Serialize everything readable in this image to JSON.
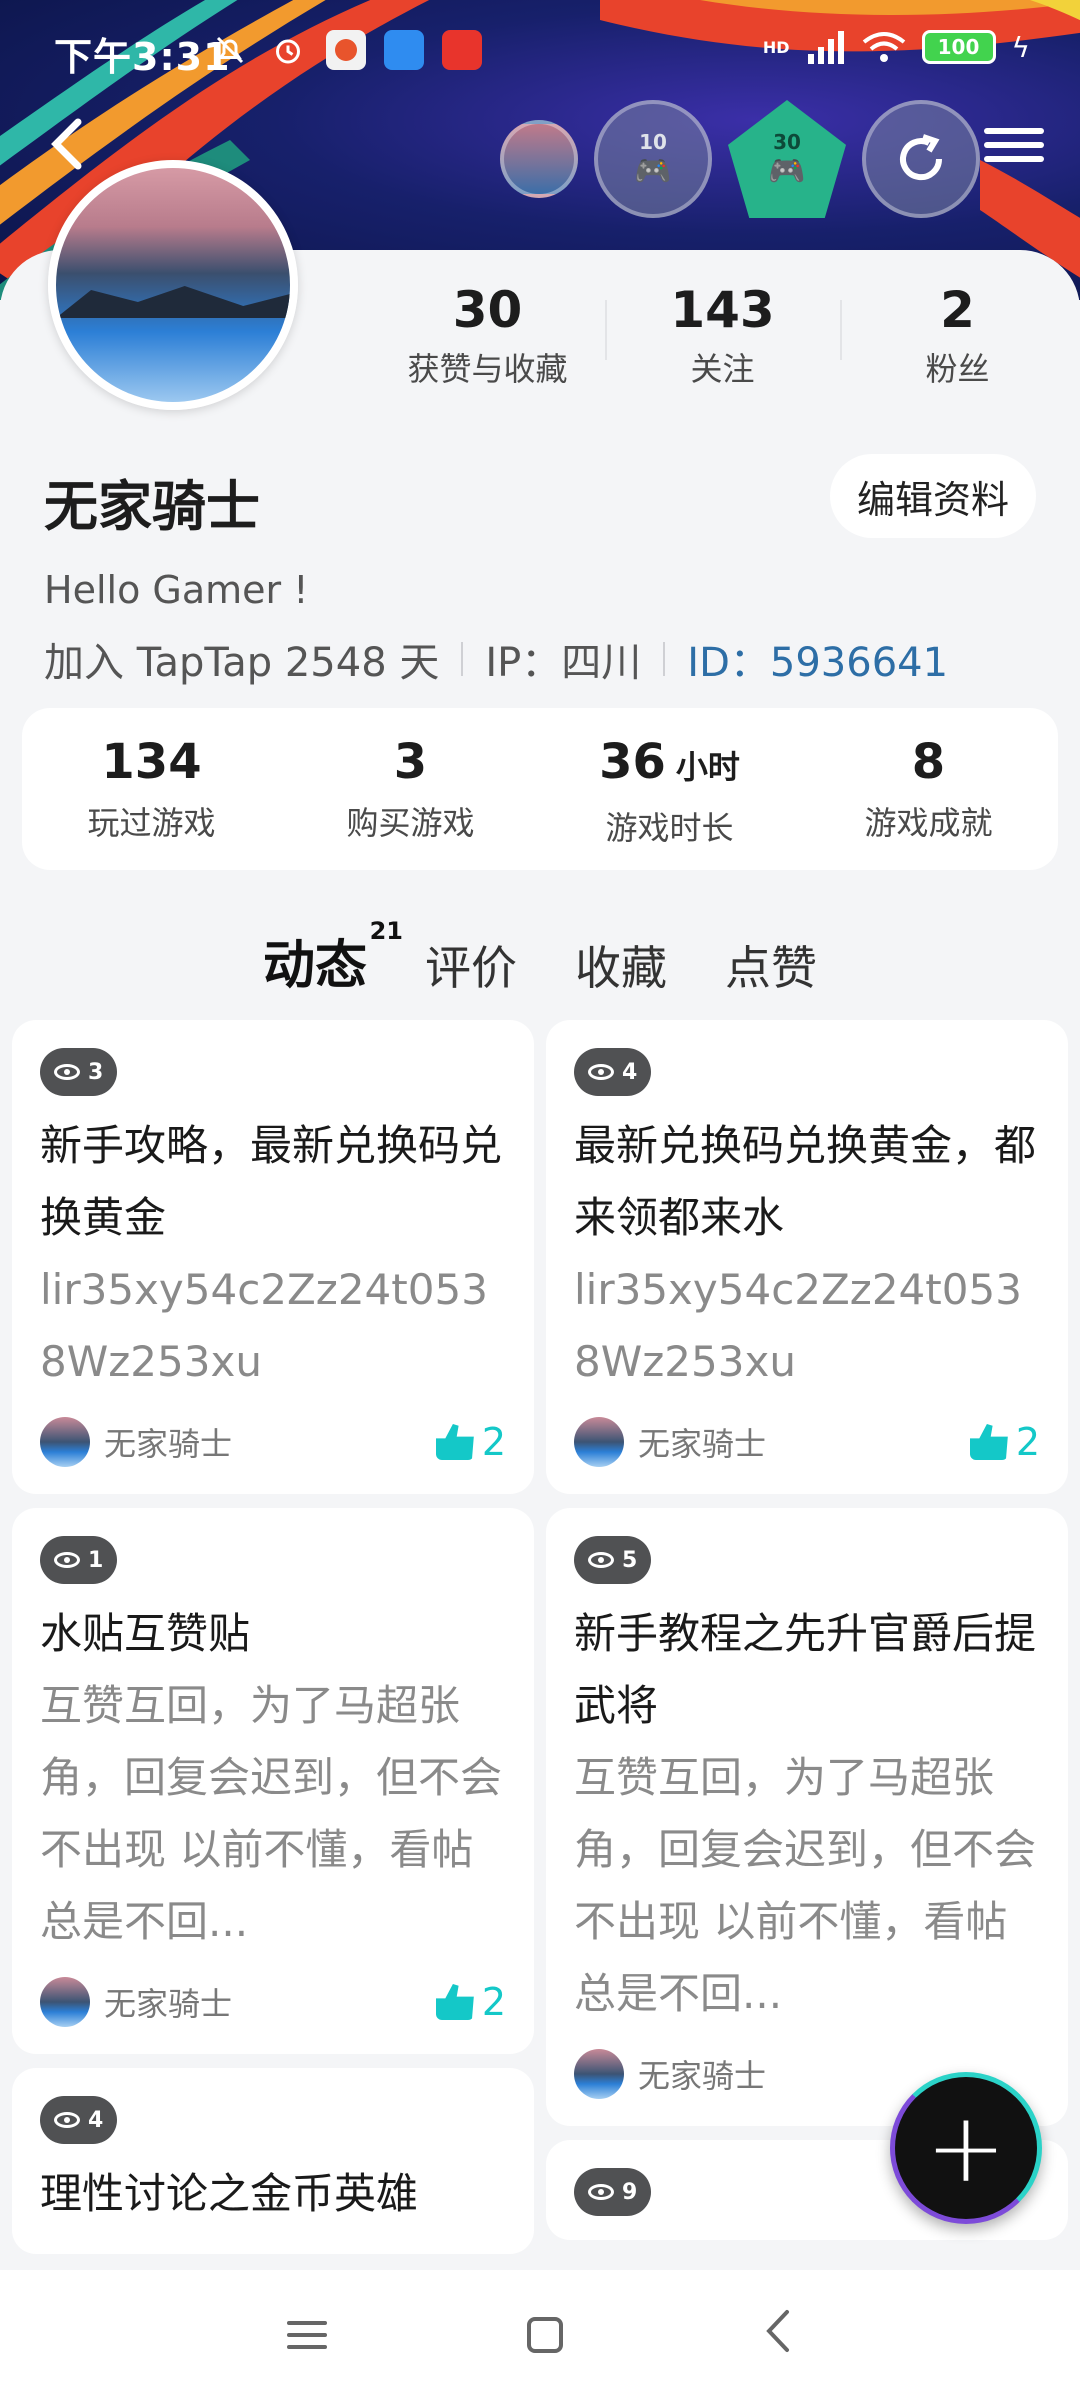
{
  "status_bar": {
    "time": "下午3:31",
    "network": "HD",
    "battery": "100",
    "app_icons": [
      "notification-off-icon",
      "alarm-icon",
      "app-icon-1",
      "app-icon-2",
      "app-icon-3"
    ]
  },
  "header": {
    "badges": [
      {
        "type": "small-avatar"
      },
      {
        "type": "circle",
        "number": "10"
      },
      {
        "type": "pentagon",
        "number": "30"
      },
      {
        "type": "circle-refresh"
      }
    ]
  },
  "profile": {
    "followers_stats": [
      {
        "num": "30",
        "label": "获赞与收藏"
      },
      {
        "num": "143",
        "label": "关注"
      },
      {
        "num": "2",
        "label": "粉丝"
      }
    ],
    "username": "无家骑士",
    "edit_label": "编辑资料",
    "bio": "Hello Gamer !",
    "join": "加入 TapTap 2548 天",
    "ip": "IP：四川",
    "id": "ID：5936641"
  },
  "game_stats": [
    {
      "num": "134",
      "unit": "",
      "label": "玩过游戏"
    },
    {
      "num": "3",
      "unit": "",
      "label": "购买游戏"
    },
    {
      "num": "36",
      "unit": "小时",
      "label": "游戏时长"
    },
    {
      "num": "8",
      "unit": "",
      "label": "游戏成就"
    }
  ],
  "tabs": [
    {
      "label": "动态",
      "count": "21"
    },
    {
      "label": "评价"
    },
    {
      "label": "收藏"
    },
    {
      "label": "点赞"
    }
  ],
  "feed": {
    "left": [
      {
        "views": "3",
        "title": "新手攻略，最新兑换码兑换黄金",
        "body": "lir35xy54c2Zz24t0538Wz253xu",
        "author": "无家骑士",
        "likes": "2"
      },
      {
        "views": "1",
        "title": "水贴互赞贴",
        "body": "互赞互回，为了马超张角，回复会迟到，但不会不出现 以前不懂，看帖总是不回...",
        "author": "无家骑士",
        "likes": "2"
      },
      {
        "views": "4",
        "title": "理性讨论之金币英雄",
        "body": "",
        "author": "",
        "likes": ""
      }
    ],
    "right": [
      {
        "views": "4",
        "title": "最新兑换码兑换黄金，都来领都来水",
        "body": "lir35xy54c2Zz24t0538Wz253xu",
        "author": "无家骑士",
        "likes": "2"
      },
      {
        "views": "5",
        "title": "新手教程之先升官爵后提武将",
        "body": "互赞互回，为了马超张角，回复会迟到，但不会不出现 以前不懂，看帖总是不回...",
        "author": "无家骑士",
        "likes": ""
      },
      {
        "views": "9",
        "title": "",
        "body": "",
        "author": "",
        "likes": ""
      }
    ]
  },
  "fab_label": "+",
  "colors": {
    "accent": "#14c8c8",
    "id_blue": "#2d6ea6",
    "banner": "#17206b"
  }
}
